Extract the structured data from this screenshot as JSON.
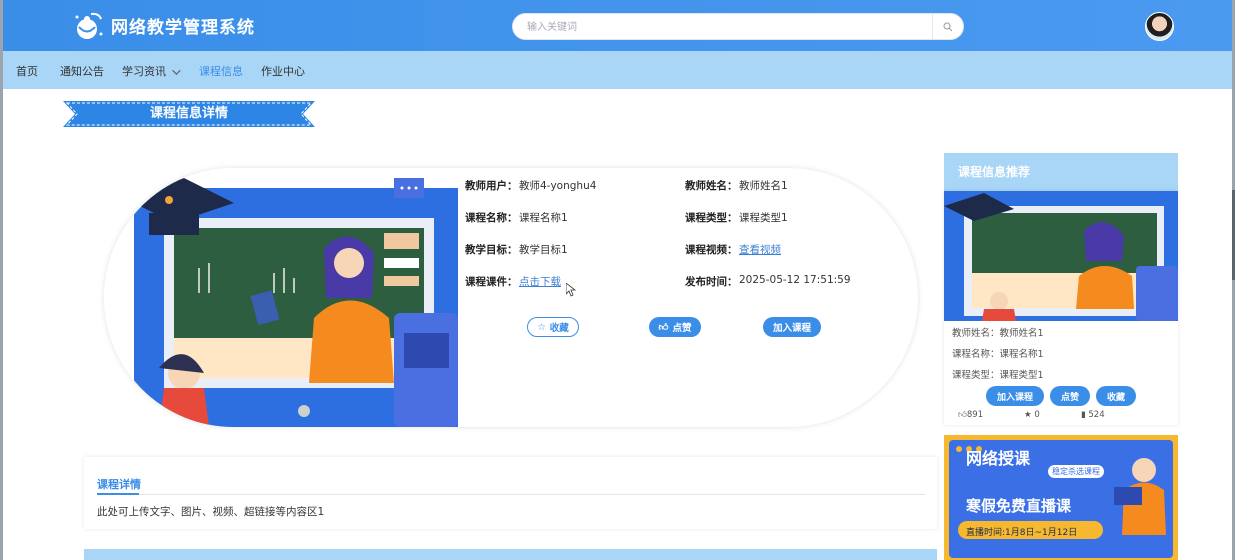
{
  "header": {
    "site_title": "网络教学管理系统",
    "search_placeholder": "输入关键词"
  },
  "nav": {
    "items": [
      {
        "label": "首页"
      },
      {
        "label": "通知公告"
      },
      {
        "label": "学习资讯"
      },
      {
        "label": "课程信息"
      },
      {
        "label": "作业中心"
      }
    ],
    "active_index": 3
  },
  "page_title": "课程信息详情",
  "course": {
    "teacher_user_label": "教师用户：",
    "teacher_user": "教师4-yonghu4",
    "teacher_name_label": "教师姓名：",
    "teacher_name": "教师姓名1",
    "course_name_label": "课程名称：",
    "course_name": "课程名称1",
    "course_type_label": "课程类型：",
    "course_type": "课程类型1",
    "goal_label": "教学目标：",
    "goal": "教学目标1",
    "video_label": "课程视频：",
    "video_link": "查看视频",
    "courseware_label": "课程课件：",
    "courseware_link": "点击下载",
    "publish_label": "发布时间：",
    "publish_time": "2025-05-12 17:51:59",
    "buttons": {
      "favorite": "收藏",
      "like": "点赞",
      "join": "加入课程"
    }
  },
  "details": {
    "tab": "课程详情",
    "content": "此处可上传文字、图片、视频、超链接等内容区1"
  },
  "recommend": {
    "title": "课程信息推荐",
    "teacher_line": "教师姓名：教师姓名1",
    "course_line": "课程名称：课程名称1",
    "type_line": "课程类型：课程类型1",
    "buttons": {
      "join": "加入课程",
      "like": "点赞",
      "favorite": "收藏"
    },
    "stats": {
      "likes": "891",
      "favorites": "0",
      "views": "524"
    }
  },
  "promo": {
    "line1": "网络授课",
    "badge": "稳定杀选课程",
    "line2": "寒假免费直播课",
    "time": "直播时间:1月8日~1月12日"
  },
  "colors": {
    "primary": "#3a8ee8",
    "nav_bg": "#a9d5f6"
  }
}
